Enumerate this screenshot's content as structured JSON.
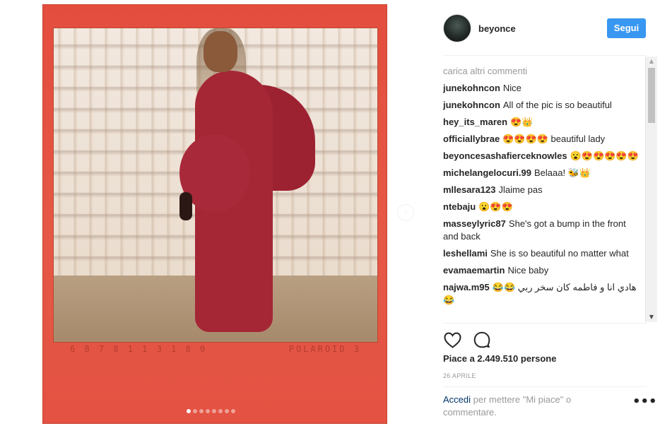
{
  "post": {
    "username": "beyonce",
    "follow_label": "Segui",
    "load_more_label": "carica altri commenti",
    "comments": [
      {
        "user": "junekohncon",
        "text": "Nice"
      },
      {
        "user": "junekohncon",
        "text": "All of the pic is so beautiful"
      },
      {
        "user": "hey_its_maren",
        "text": "😍👑"
      },
      {
        "user": "officiallybrae",
        "text": "😍😍😍😍 beautiful lady"
      },
      {
        "user": "beyoncesashafierceknowles",
        "text": "😮😍😍😍😍😍"
      },
      {
        "user": "michelangelocuri.99",
        "text": "Belaaa! 🐝👑"
      },
      {
        "user": "mllesara123",
        "text": "Jlaime pas"
      },
      {
        "user": "ntebaju",
        "text": "😮😍😍"
      },
      {
        "user": "masseylyric87",
        "text": "She's got a bump in the front and back"
      },
      {
        "user": "leshellami",
        "text": "She is so beautiful no matter what"
      },
      {
        "user": "evamaemartin",
        "text": "Nice baby"
      },
      {
        "user": "najwa.m95",
        "text": "هادي انا و فاطمه كان سخر ربي 😂😂😂"
      }
    ],
    "likes_label": "Piace a 2.449.510 persone",
    "date_label": "26 APRILE",
    "login_link": "Accedi",
    "login_text": " per mettere \"Mi piace\" o commentare.",
    "more_label": "•••",
    "carousel": {
      "total": 8,
      "active": 0
    },
    "polaroid_strip_left": "6 8 7 8 1 1 3 1 8 0",
    "polaroid_strip_right": "POLAROID 3",
    "icons": {
      "like": "heart-icon",
      "comment": "speech-bubble-icon",
      "next": "chevron-right-icon",
      "more": "more-options-icon"
    },
    "colors": {
      "follow_button": "#3897f0",
      "polaroid_frame": "#e34d3e",
      "dress": "#a52736",
      "muted_text": "#999999",
      "link": "#003569"
    }
  }
}
